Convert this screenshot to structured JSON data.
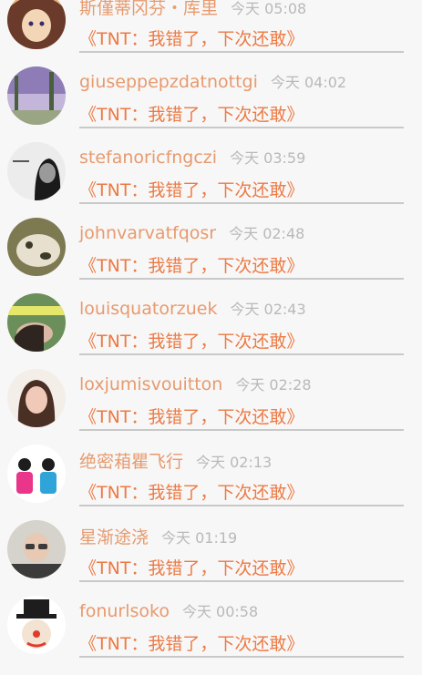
{
  "conversations": [
    {
      "name": "斯僅蒂冈芬・库里",
      "time": "今天 05:08",
      "message": "《TNT：我错了，下次还敢》",
      "avatar_icon": "anime-girl-avatar",
      "avatar_colors": [
        "#e7b07a",
        "#6a3b2a",
        "#f3d6b5"
      ]
    },
    {
      "name": "giuseppepzdatnottgi",
      "time": "今天 04:02",
      "message": "《TNT：我错了，下次还敢》",
      "avatar_icon": "purple-forest-avatar",
      "avatar_colors": [
        "#8e7cb6",
        "#c3b6da",
        "#4a5f3c"
      ]
    },
    {
      "name": "stefanoricfngczi",
      "time": "今天 03:59",
      "message": "《TNT：我错了，下次还敢》",
      "avatar_icon": "bw-person-avatar",
      "avatar_colors": [
        "#ececec",
        "#1a1a1a",
        "#9a9a9a"
      ]
    },
    {
      "name": "johnvarvatfqosr",
      "time": "今天 02:48",
      "message": "《TNT：我错了，下次还敢》",
      "avatar_icon": "pet-avatar",
      "avatar_colors": [
        "#7d7a52",
        "#e8e0cf",
        "#3b3a28"
      ]
    },
    {
      "name": "louisquatorzuek",
      "time": "今天 02:43",
      "message": "《TNT：我错了，下次还敢》",
      "avatar_icon": "sleeping-girl-avatar",
      "avatar_colors": [
        "#e6e66a",
        "#6b8f5a",
        "#d9b9a5"
      ]
    },
    {
      "name": "loxjumisvouitton",
      "time": "今天 02:28",
      "message": "《TNT：我错了，下次还敢》",
      "avatar_icon": "girl-portrait-avatar",
      "avatar_colors": [
        "#f4eee9",
        "#4a2f24",
        "#f0c9b8"
      ]
    },
    {
      "name": "绝密葙瞿飞行",
      "time": "今天 02:13",
      "message": "《TNT：我错了，下次还敢》",
      "avatar_icon": "mickey-figures-avatar",
      "avatar_colors": [
        "#ffffff",
        "#e9358a",
        "#2fa4d8"
      ]
    },
    {
      "name": "星渐途浇",
      "time": "今天 01:19",
      "message": "《TNT：我错了，下次还敢》",
      "avatar_icon": "child-sunglasses-avatar",
      "avatar_colors": [
        "#d6d2cc",
        "#3b3b3b",
        "#e8c9b3"
      ]
    },
    {
      "name": "fonurlsoko",
      "time": "今天 00:58",
      "message": "《TNT：我错了，下次还敢》",
      "avatar_icon": "clown-avatar",
      "avatar_colors": [
        "#ffffff",
        "#1d1d1d",
        "#e23b2e"
      ]
    }
  ]
}
